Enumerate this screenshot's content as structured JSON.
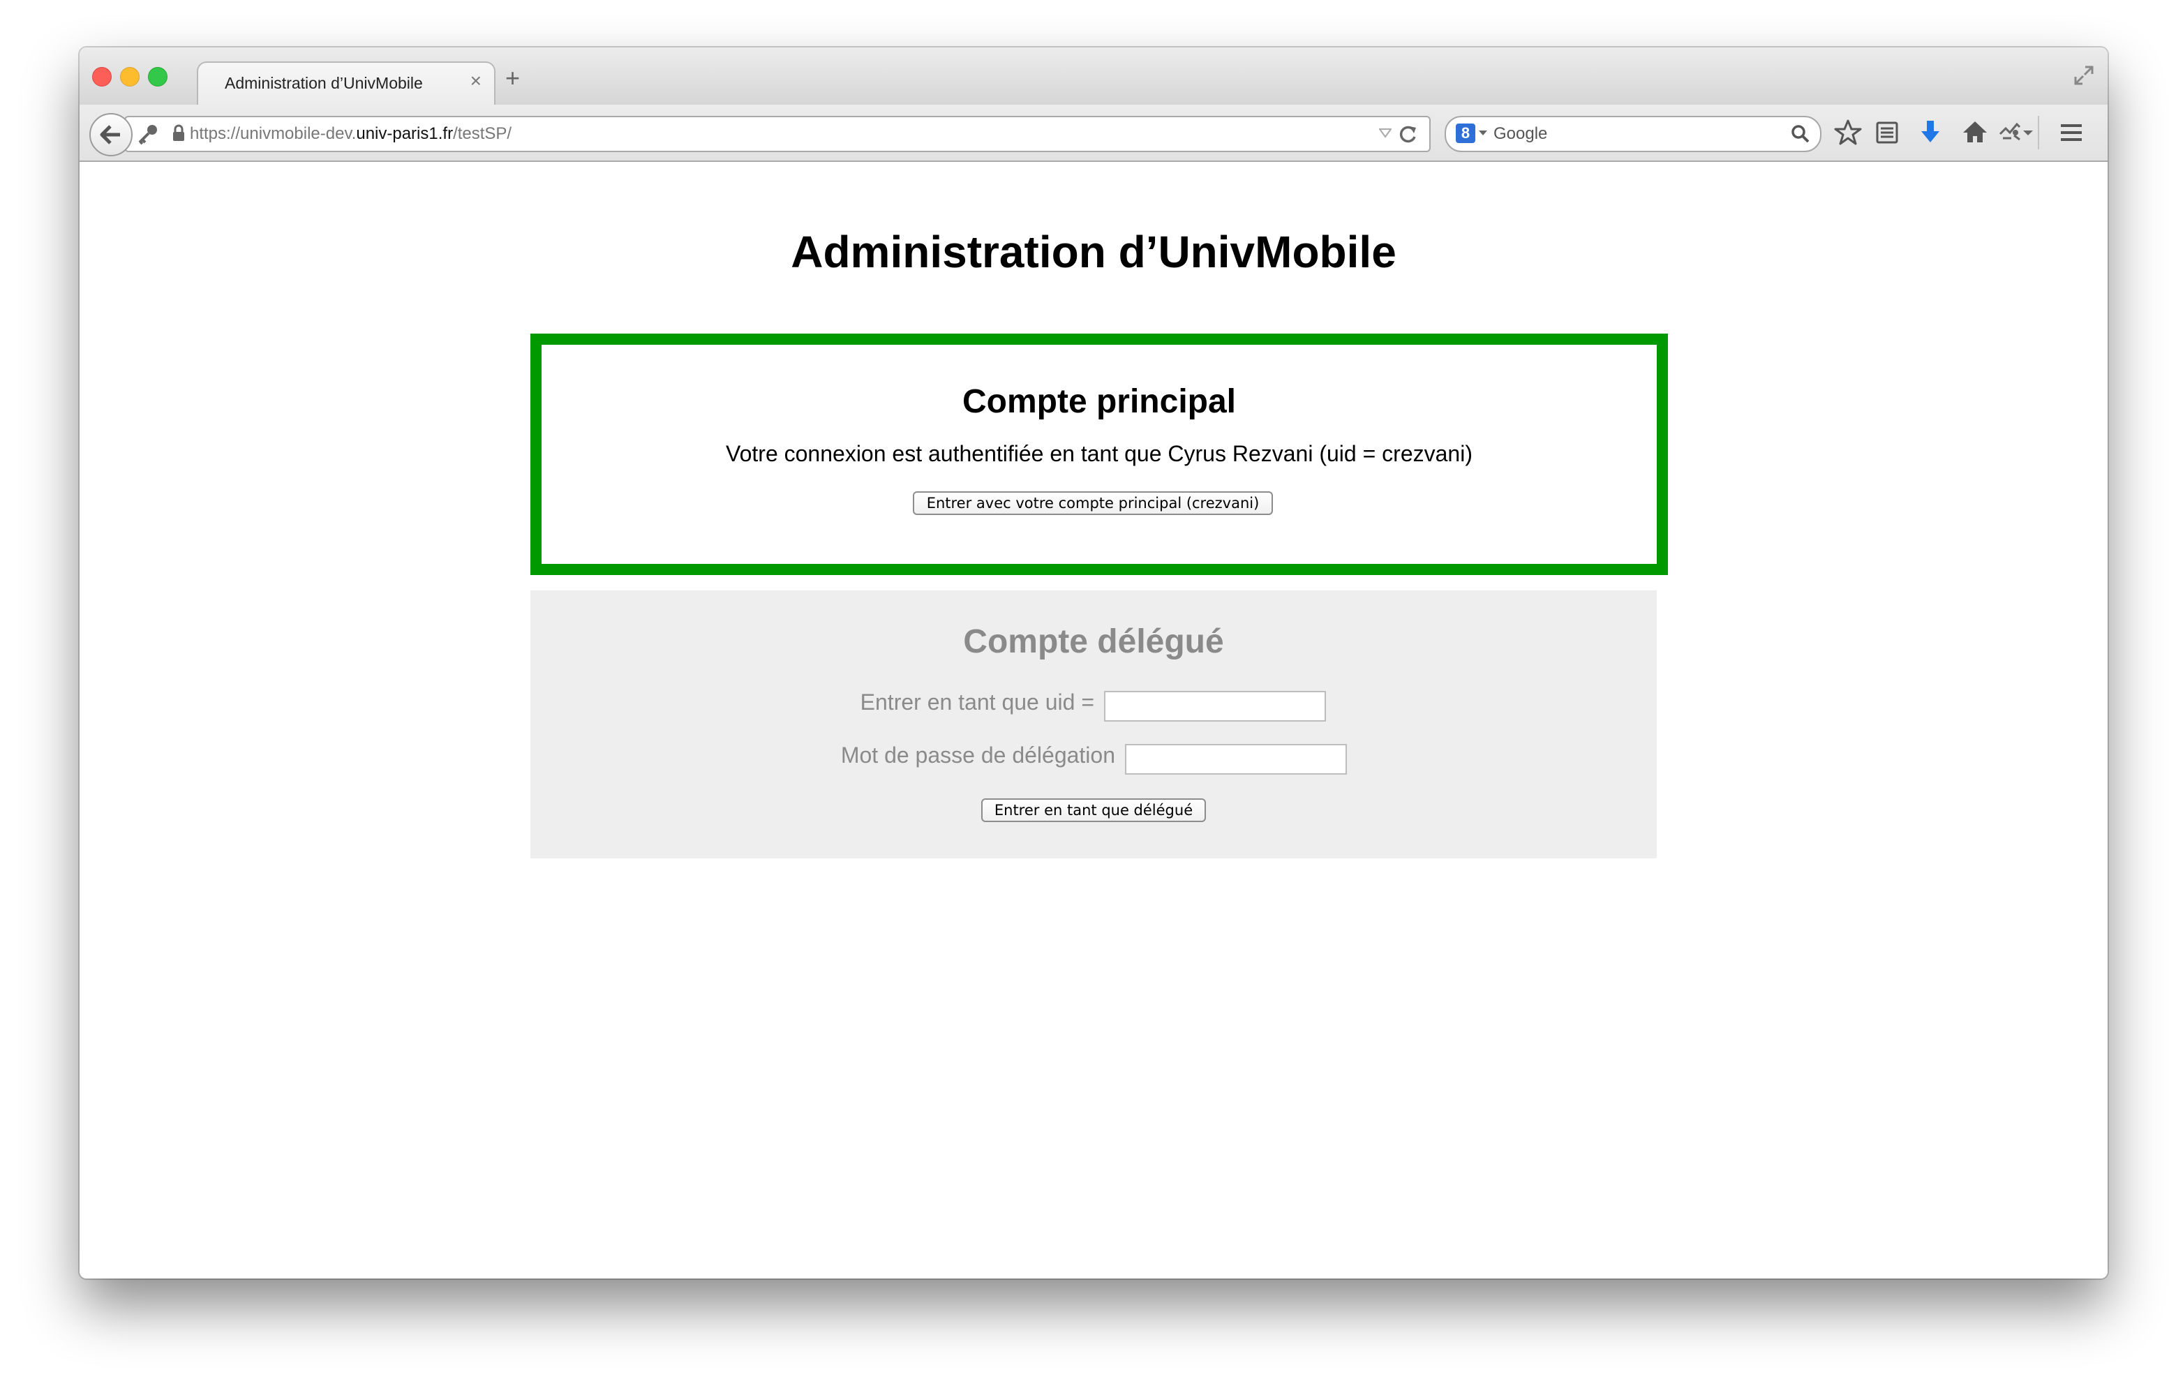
{
  "browser": {
    "tab": {
      "title": "Administration d’UnivMobile"
    },
    "url": {
      "prefix": "https://univmobile-dev.",
      "domain": "univ-paris1.fr",
      "path": "/testSP/"
    },
    "search": {
      "placeholder": "Google",
      "engine_logo": "8"
    }
  },
  "page": {
    "title": "Administration d’UnivMobile",
    "primary": {
      "title": "Compte principal",
      "text": "Votre connexion est authentifiée en tant que Cyrus Rezvani (uid = crezvani)",
      "button_label": "Entrer avec votre compte principal (crezvani)"
    },
    "delegate": {
      "title": "Compte délégué",
      "uid_label": "Entrer en tant que uid =",
      "uid_value": "",
      "password_label": "Mot de passe de délégation",
      "password_value": "",
      "button_label": "Entrer en tant que délégué"
    }
  },
  "colors": {
    "primary_border": "#009900",
    "delegate_background": "#eeeeee",
    "muted_text": "#8a8a8a",
    "download_arrow": "#1f78e6"
  },
  "icons": [
    "close-window-icon",
    "minimize-window-icon",
    "zoom-window-icon",
    "tab-close-icon",
    "new-tab-icon",
    "fullscreen-icon",
    "back-arrow-icon",
    "key-icon",
    "lock-icon",
    "url-dropdown-icon",
    "reload-icon",
    "google-logo-icon",
    "search-icon",
    "bookmark-star-icon",
    "reading-list-icon",
    "download-icon",
    "home-icon",
    "extension-icon",
    "overflow-chevron-icon",
    "menu-icon"
  ]
}
